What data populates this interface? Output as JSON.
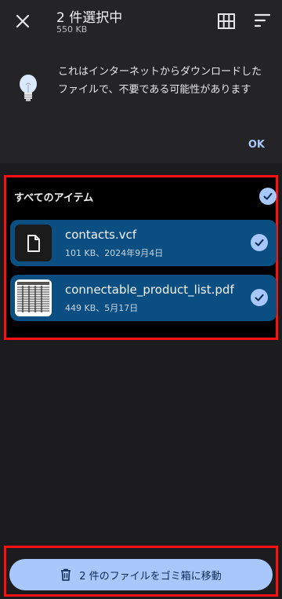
{
  "header": {
    "title": "2 件選択中",
    "subtitle": "550 KB",
    "icons": [
      "close-icon",
      "grid-view-icon",
      "sort-icon"
    ]
  },
  "banner": {
    "message": "これはインターネットからダウンロードしたファイルで、不要である可能性があります",
    "ok_label": "OK",
    "icon": "lightbulb-icon"
  },
  "selection": {
    "all_items_label": "すべてのアイテム",
    "all_checked": true
  },
  "files": [
    {
      "name": "contacts.vcf",
      "meta": "101 KB、2024年9月4日",
      "icon": "document-icon",
      "checked": true
    },
    {
      "name": "connectable_product_list.pdf",
      "meta": "449 KB、5月17日",
      "icon": "pdf-thumbnail",
      "checked": true
    }
  ],
  "action": {
    "trash_label": "2 件のファイルをゴミ箱に移動",
    "icon": "trash-icon"
  },
  "colors": {
    "accent": "#a8c7fa",
    "row_bg": "#0b4f82",
    "highlight_border": "#ff1010"
  }
}
